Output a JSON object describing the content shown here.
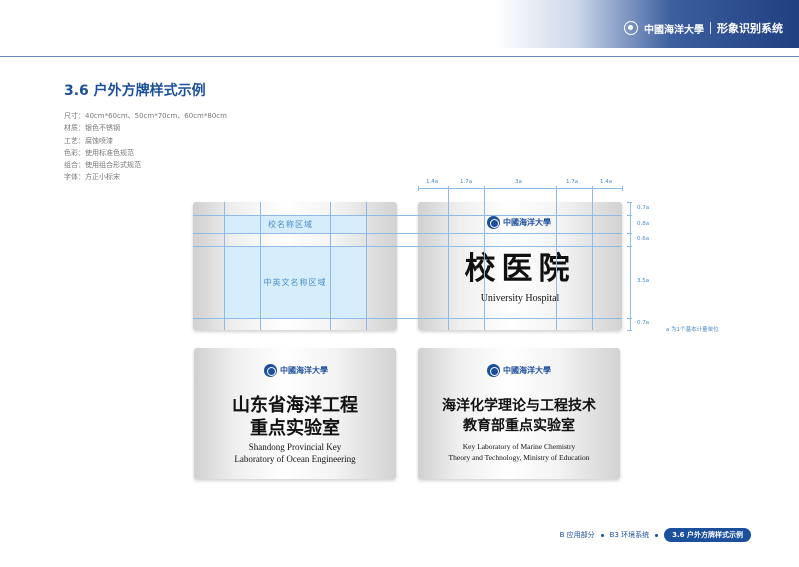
{
  "header": {
    "logo_text": "中國海洋大學",
    "system_title": "形象识别系统"
  },
  "section_title": "3.6 户外方牌样式示例",
  "specs": [
    {
      "label": "尺寸",
      "value": "40cm*60cm、50cm*70cm、60cm*80cm"
    },
    {
      "label": "材质",
      "value": "银色不锈钢"
    },
    {
      "label": "工艺",
      "value": "腐蚀喷漆"
    },
    {
      "label": "色彩",
      "value": "使用标准色规范"
    },
    {
      "label": "组合",
      "value": "使用组合形式规范"
    },
    {
      "label": "字体",
      "value": "方正小标宋"
    }
  ],
  "template": {
    "name_zone_label": "校名称区域",
    "main_zone_label": "中英文名称区域"
  },
  "dimensions": {
    "top": [
      "1.4a",
      "1.7a",
      "3a",
      "1.7a",
      "1.4a"
    ],
    "right": [
      "0.7a",
      "0.8a",
      "0.6a",
      "3.5a",
      "0.7a"
    ],
    "unit_note": "a 为1个基本计量单位"
  },
  "signs": {
    "hospital": {
      "cn": "校医院",
      "en": "University Hospital"
    },
    "lab_ocean": {
      "cn_lines": [
        "山东省海洋工程",
        "重点实验室"
      ],
      "en_lines": [
        "Shandong Provincial Key",
        "Laboratory of Ocean Engineering"
      ]
    },
    "lab_chem": {
      "cn_lines": [
        "海洋化学理论与工程技术",
        "教育部重点实验室"
      ],
      "en_lines": [
        "Key Laboratory of Marine Chemistry",
        "Theory and Technology, Ministry of Education"
      ]
    }
  },
  "footer": {
    "crumbs": [
      "B 应用部分",
      "B3 环境系统"
    ],
    "current": "3.6 户外方牌样式示例"
  },
  "colors": {
    "brand_blue": "#1c4f9c",
    "guide_blue": "#8ebbe6",
    "zone_fill": "#d6eefb"
  }
}
